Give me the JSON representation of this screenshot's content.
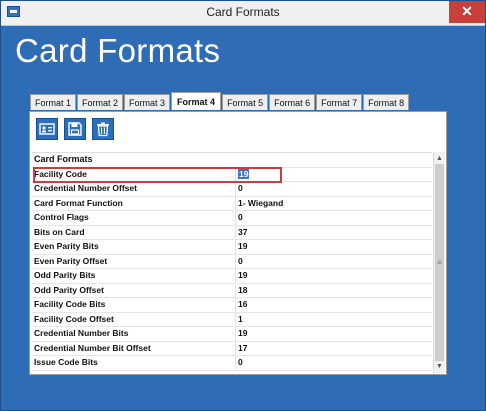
{
  "window": {
    "title": "Card Formats",
    "close_glyph": "✕"
  },
  "page": {
    "title": "Card Formats"
  },
  "tabs": [
    {
      "label": "Format 1",
      "active": false
    },
    {
      "label": "Format 2",
      "active": false
    },
    {
      "label": "Format 3",
      "active": false
    },
    {
      "label": "Format 4",
      "active": true
    },
    {
      "label": "Format 5",
      "active": false
    },
    {
      "label": "Format 6",
      "active": false
    },
    {
      "label": "Format 7",
      "active": false
    },
    {
      "label": "Format 8",
      "active": false
    }
  ],
  "toolbar": {
    "icons": [
      "id-card-icon",
      "save-icon",
      "trash-icon"
    ]
  },
  "grid": {
    "category": "Card Formats",
    "rows": [
      {
        "key": "Facility Code",
        "value": "19",
        "selected": true
      },
      {
        "key": "Credential Number Offset",
        "value": "0"
      },
      {
        "key": "Card Format Function",
        "value": "1- Wiegand"
      },
      {
        "key": "Control Flags",
        "value": "0"
      },
      {
        "key": "Bits on Card",
        "value": "37"
      },
      {
        "key": "Even Parity Bits",
        "value": "19"
      },
      {
        "key": "Even Parity Offset",
        "value": "0"
      },
      {
        "key": "Odd Parity Bits",
        "value": "19"
      },
      {
        "key": "Odd Parity Offset",
        "value": "18"
      },
      {
        "key": "Facility Code Bits",
        "value": "16"
      },
      {
        "key": "Facility Code Offset",
        "value": "1"
      },
      {
        "key": "Credential Number Bits",
        "value": "19"
      },
      {
        "key": "Credential Number Bit Offset",
        "value": "17"
      },
      {
        "key": "Issue Code Bits",
        "value": "0"
      }
    ]
  },
  "colors": {
    "background": "#2e6cb5",
    "highlight": "#d43a3a",
    "selection": "#3c73d0"
  }
}
